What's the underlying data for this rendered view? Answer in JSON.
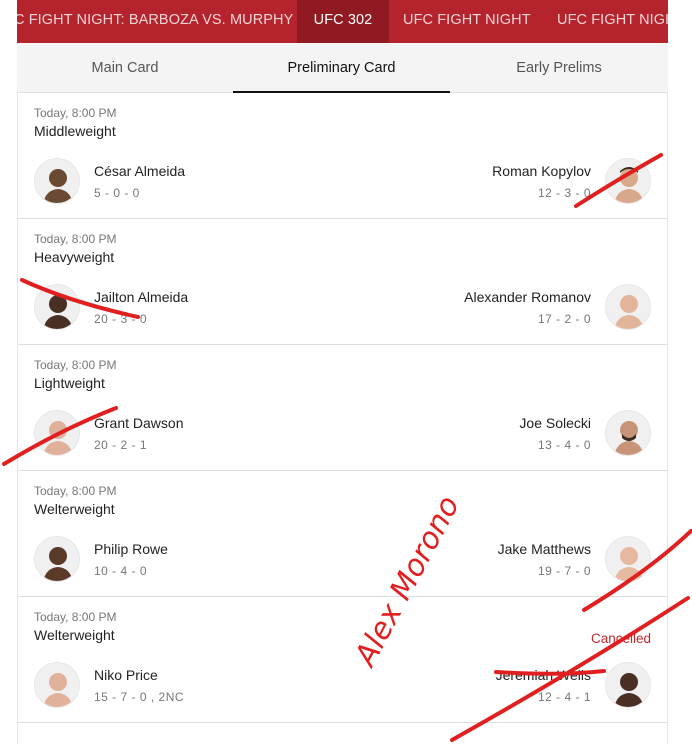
{
  "event_tabs": [
    {
      "label": "C FIGHT NIGHT: BARBOZA VS. MURPHY",
      "active": false
    },
    {
      "label": "UFC 302",
      "active": true
    },
    {
      "label": "UFC FIGHT NIGHT",
      "active": false
    },
    {
      "label": "UFC FIGHT NIGH",
      "active": false
    }
  ],
  "card_tabs": [
    {
      "label": "Main Card",
      "active": false
    },
    {
      "label": "Preliminary Card",
      "active": true
    },
    {
      "label": "Early Prelims",
      "active": false
    }
  ],
  "fights": [
    {
      "time": "Today, 8:00 PM",
      "weight_class": "Middleweight",
      "status": "",
      "left": {
        "name": "César Almeida",
        "record": "5 - 0 - 0"
      },
      "right": {
        "name": "Roman Kopylov",
        "record": "12 - 3 - 0"
      }
    },
    {
      "time": "Today, 8:00 PM",
      "weight_class": "Heavyweight",
      "status": "",
      "left": {
        "name": "Jailton Almeida",
        "record": "20 - 3 - 0"
      },
      "right": {
        "name": "Alexander Romanov",
        "record": "17 - 2 - 0"
      }
    },
    {
      "time": "Today, 8:00 PM",
      "weight_class": "Lightweight",
      "status": "",
      "left": {
        "name": "Grant Dawson",
        "record": "20 - 2 - 1"
      },
      "right": {
        "name": "Joe Solecki",
        "record": "13 - 4 - 0"
      }
    },
    {
      "time": "Today, 8:00 PM",
      "weight_class": "Welterweight",
      "status": "",
      "left": {
        "name": "Philip Rowe",
        "record": "10 - 4 - 0"
      },
      "right": {
        "name": "Jake Matthews",
        "record": "19 - 7 - 0"
      }
    },
    {
      "time": "Today, 8:00 PM",
      "weight_class": "Welterweight",
      "status": "Cancelled",
      "left": {
        "name": "Niko Price",
        "record": "15 - 7 - 0 , 2NC"
      },
      "right": {
        "name": "Jeremiah Wells",
        "record": "12 - 4 - 1"
      }
    }
  ],
  "annotation": {
    "handwriting": "Alex Morono",
    "color": "#e02020"
  },
  "colors": {
    "brand_red": "#b5242c",
    "active_tab": "#8f1a21",
    "cancelled": "#c0272d"
  }
}
